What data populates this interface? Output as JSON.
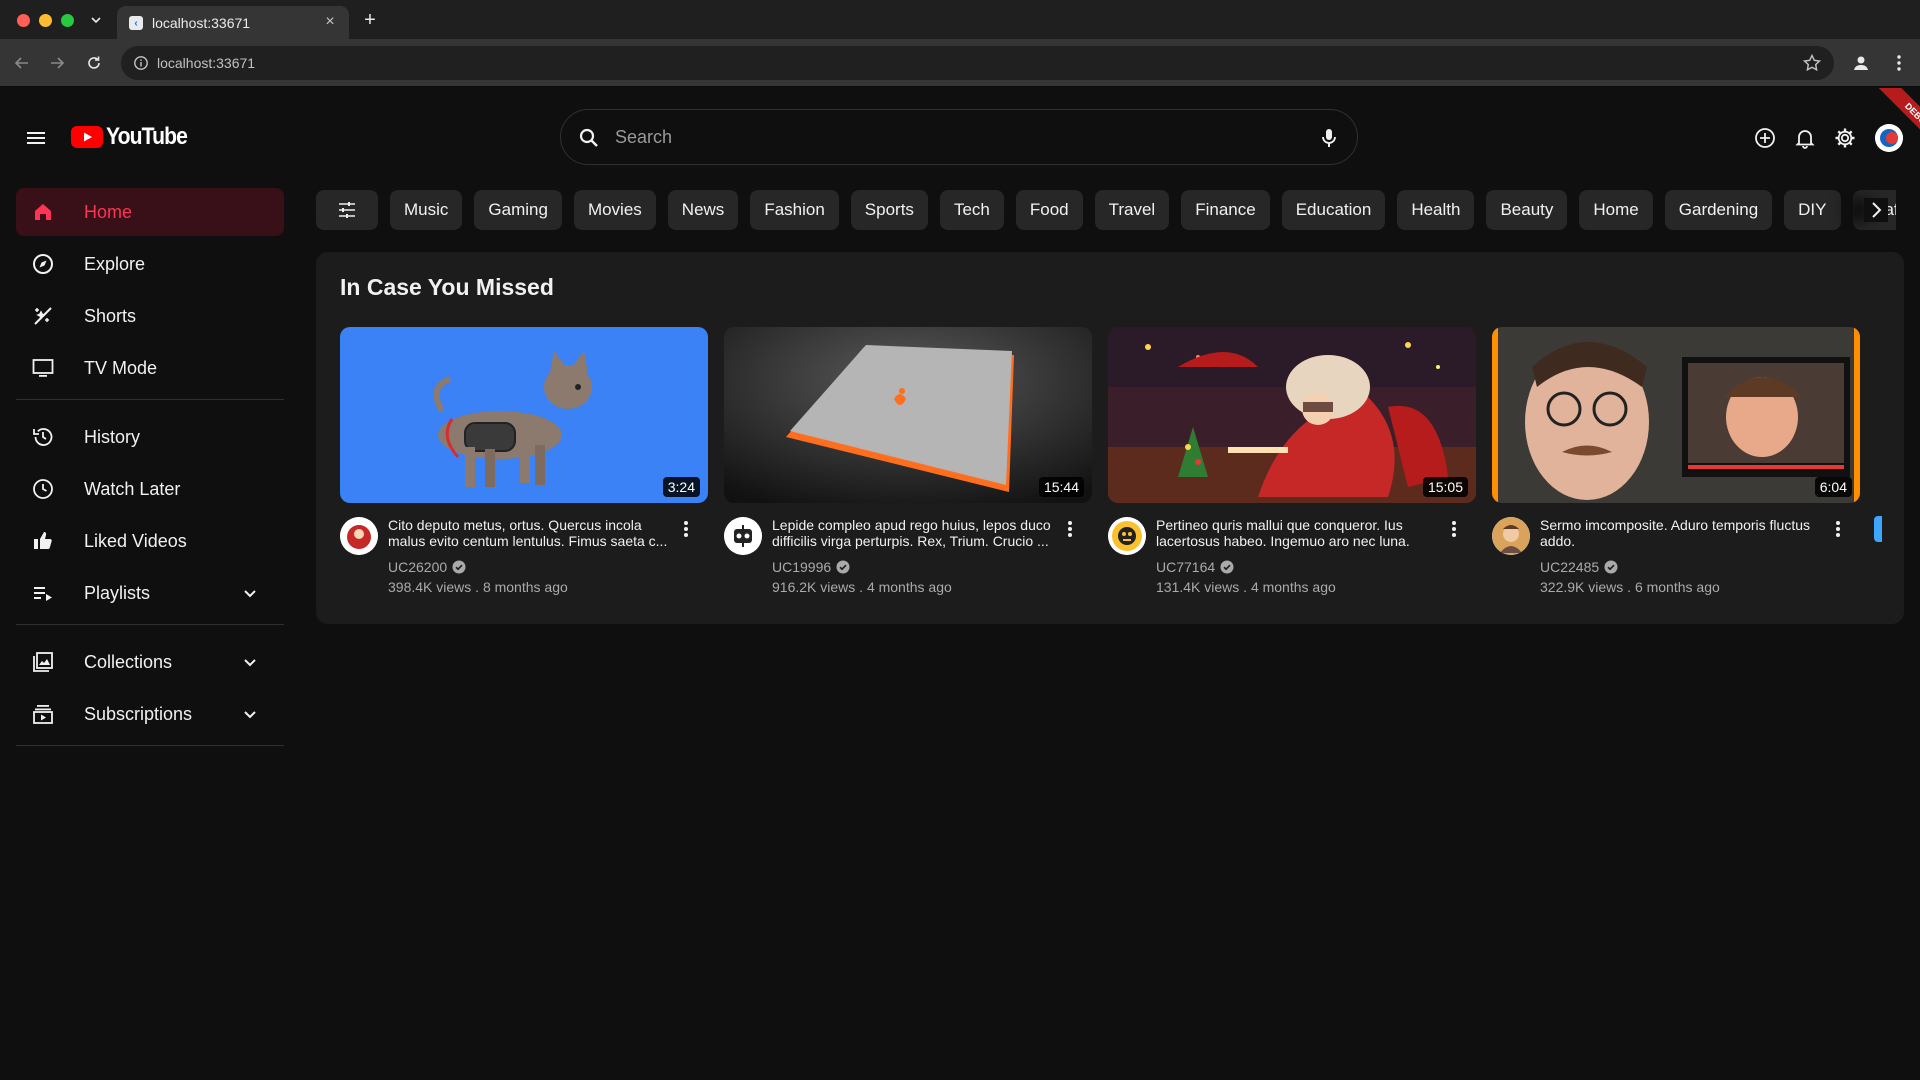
{
  "browser": {
    "tab_title": "localhost:33671",
    "tab_close": "×",
    "new_tab": "+",
    "url": "localhost:33671"
  },
  "masthead": {
    "logo_text": "YouTube",
    "search_placeholder": "Search",
    "debug_label": "DEBUG"
  },
  "sidebar": {
    "items": [
      {
        "label": "Home",
        "icon": "home-icon",
        "active": true
      },
      {
        "label": "Explore",
        "icon": "compass-icon"
      },
      {
        "label": "Shorts",
        "icon": "shorts-icon"
      },
      {
        "label": "TV Mode",
        "icon": "tv-icon"
      },
      {
        "label": "History",
        "icon": "history-icon"
      },
      {
        "label": "Watch Later",
        "icon": "clock-icon"
      },
      {
        "label": "Liked Videos",
        "icon": "thumbs-up-icon"
      },
      {
        "label": "Playlists",
        "icon": "playlist-icon",
        "expandable": true
      },
      {
        "label": "Collections",
        "icon": "collections-icon",
        "expandable": true
      },
      {
        "label": "Subscriptions",
        "icon": "subscriptions-icon",
        "expandable": true
      }
    ]
  },
  "chips": [
    "Music",
    "Gaming",
    "Movies",
    "News",
    "Fashion",
    "Sports",
    "Tech",
    "Food",
    "Travel",
    "Finance",
    "Education",
    "Health",
    "Beauty",
    "Home",
    "Gardening",
    "DIY",
    "Crafts"
  ],
  "shelf": {
    "title": "In Case You Missed",
    "videos": [
      {
        "duration": "3:24",
        "title": "Cito deputo metus, ortus. Quercus incola malus evito centum lentulus. Fimus saeta c...",
        "channel": "UC26200",
        "stats": "398.4K views . 8 months ago"
      },
      {
        "duration": "15:44",
        "title": "Lepide compleo apud rego huius, lepos duco difficilis virga perturpis. Rex, Trium. Crucio ...",
        "channel": "UC19996",
        "stats": "916.2K views . 4 months ago"
      },
      {
        "duration": "15:05",
        "title": "Pertineo quris mallui que conqueror. Ius lacertosus habeo. Ingemuo aro nec luna.",
        "channel": "UC77164",
        "stats": "131.4K views . 4 months ago"
      },
      {
        "duration": "6:04",
        "title": "Sermo imcomposite. Aduro temporis fluctus addo.",
        "channel": "UC22485",
        "stats": "322.9K views . 6 months ago"
      }
    ]
  },
  "colors": {
    "background": "#0f0f0f",
    "accent": "#ff3355",
    "youtube_red": "#ff0000",
    "chip_bg": "#272727",
    "shelf_bg": "#1c1c1c"
  }
}
